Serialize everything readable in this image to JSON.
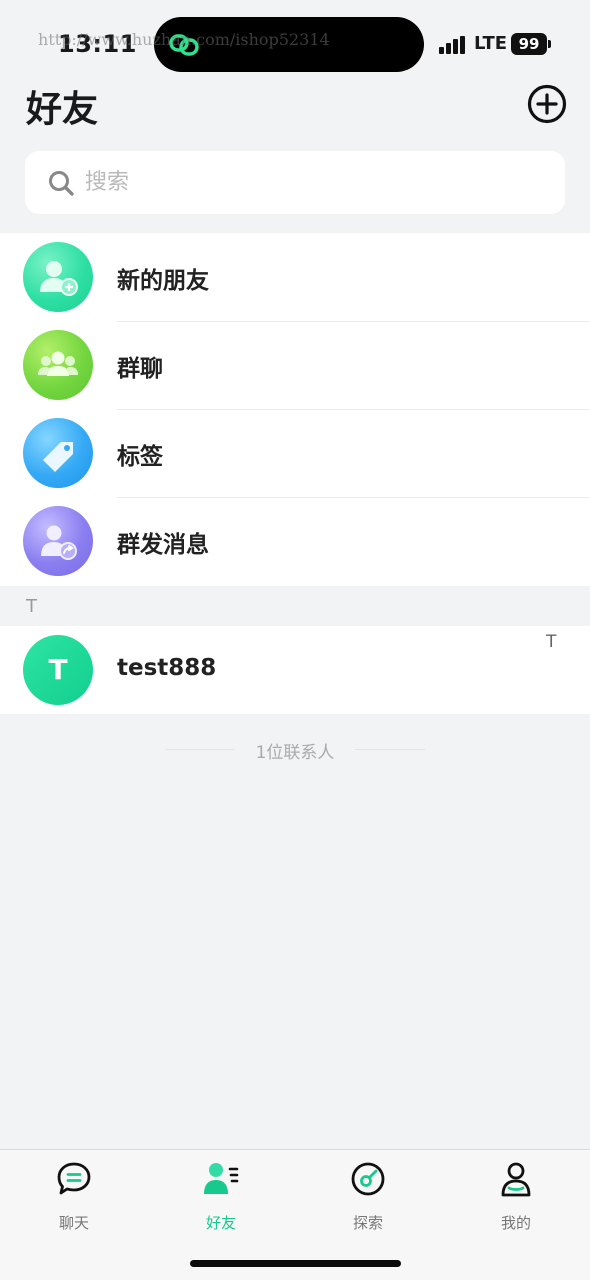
{
  "status_bar": {
    "time": "13:11",
    "watermark": "http://www.huzhan.com/ishop52314",
    "network": "LTE",
    "battery": "99"
  },
  "header": {
    "title": "好友",
    "add_icon": "plus-circle-icon"
  },
  "search": {
    "placeholder": "搜索",
    "icon": "search-icon"
  },
  "functions": [
    {
      "label": "新的朋友",
      "icon": "add-friend-icon",
      "color": "#2edfa4"
    },
    {
      "label": "群聊",
      "icon": "group-chat-icon",
      "color": "#74d640"
    },
    {
      "label": "标签",
      "icon": "tag-icon",
      "color": "#35a9f5"
    },
    {
      "label": "群发消息",
      "icon": "broadcast-icon",
      "color": "#8a7ef0"
    }
  ],
  "section": {
    "letter": "T"
  },
  "contacts": [
    {
      "initial": "T",
      "name": "test888"
    }
  ],
  "index_bar": [
    "T"
  ],
  "contact_count": "1位联系人",
  "tab_bar": {
    "active": "好友",
    "tabs": [
      {
        "label": "聊天",
        "icon": "chat-icon"
      },
      {
        "label": "好友",
        "icon": "friends-icon"
      },
      {
        "label": "探索",
        "icon": "explore-icon"
      },
      {
        "label": "我的",
        "icon": "profile-icon"
      }
    ]
  },
  "colors": {
    "accent": "#17c98d",
    "background": "#f2f3f5"
  }
}
